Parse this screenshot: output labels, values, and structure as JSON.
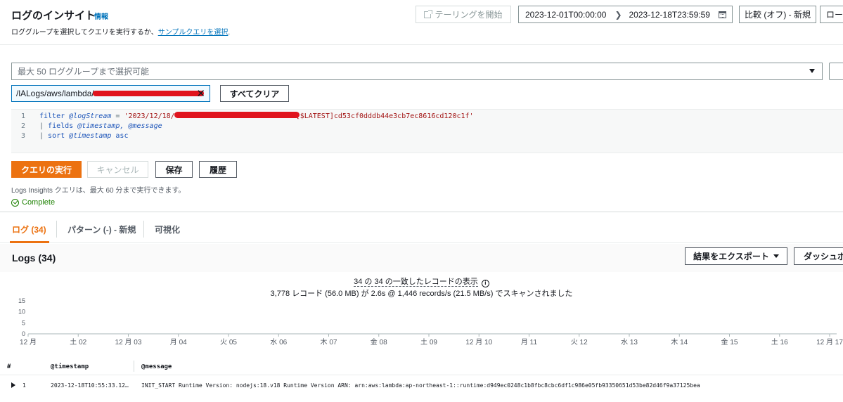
{
  "header": {
    "title": "ログのインサイト",
    "info": "情報",
    "subtitle_prefix": "ロググループを選択してクエリを実行するか、",
    "subtitle_link": "サンプルクエリを選択",
    "subtitle_suffix": "."
  },
  "toolbar": {
    "tail_label": "テーリングを開始",
    "date_start": "2023-12-01T00:00:00",
    "date_end": "2023-12-18T23:59:59",
    "compare_label": "比較 (オフ) - 新規",
    "local_label": "ロー"
  },
  "query": {
    "log_group_placeholder": "最大 50 ロググループまで選択可能",
    "selected_group": "/lALogs/aws/lambda/",
    "clear_all": "すべてクリア",
    "lines": [
      {
        "n": "1",
        "kw": "filter",
        "field": "@logStream",
        "op": " = ",
        "str_a": "'2023/12/18/",
        "str_b": "[$LATEST]cd53cf0dddb44e3cb7ec8616cd120c1f'"
      },
      {
        "n": "2",
        "text_a": "| ",
        "kw": "fields",
        "text_b": " ",
        "field": "@timestamp, @message"
      },
      {
        "n": "3",
        "text_a": "| ",
        "kw": "sort",
        "text_b": " ",
        "field": "@timestamp",
        "text_c": " asc"
      }
    ],
    "run_label": "クエリの実行",
    "cancel_label": "キャンセル",
    "save_label": "保存",
    "history_label": "履歴",
    "limit_note": "Logs Insights クエリは、最大 60 分まで実行できます。",
    "status": "Complete"
  },
  "tabs": [
    {
      "label": "ログ (34)",
      "active": true
    },
    {
      "label": "パターン (-) - 新規",
      "active": false
    },
    {
      "label": "可視化",
      "active": false
    }
  ],
  "results": {
    "title": "Logs (34)",
    "export_label": "結果をエクスポート",
    "dashboard_label": "ダッシュボ",
    "summary_line1": "34 の 34 の一致したレコードの表示",
    "summary_line2": "3,778 レコード (56.0 MB) が 2.6s @ 1,446 records/s (21.5 MB/s) でスキャンされました"
  },
  "chart_data": {
    "type": "bar",
    "categories": [
      "12 月",
      "土 02",
      "12 月 03",
      "月 04",
      "火 05",
      "水 06",
      "木 07",
      "金 08",
      "土 09",
      "12 月 10",
      "月 11",
      "火 12",
      "水 13",
      "木 14",
      "金 15",
      "土 16",
      "12 月 17"
    ],
    "series": [
      {
        "values": [
          0,
          0,
          0,
          0,
          0,
          0,
          0,
          0,
          0,
          0,
          0,
          0,
          0,
          0,
          0,
          0,
          0
        ]
      }
    ],
    "yticks": [
      "0",
      "5",
      "10",
      "15"
    ],
    "ylim": [
      0,
      15
    ],
    "accent": "#ec7211"
  },
  "table": {
    "headers": [
      "#",
      "@timestamp",
      "@message"
    ],
    "rows": [
      {
        "num": "1",
        "timestamp": "2023-12-18T10:55:33.12…",
        "message": "INIT_START Runtime Version: nodejs:18.v18 Runtime Version ARN: arn:aws:lambda:ap-northeast-1::runtime:d949ec0248c1b8fbc8cbc6df1c986e05fb93350б51d53be82d46f9a37125bea"
      }
    ]
  }
}
